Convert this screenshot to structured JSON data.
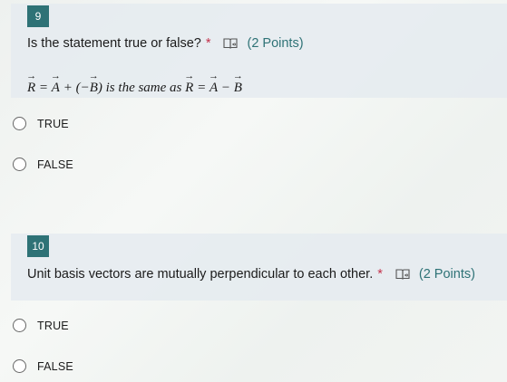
{
  "questions": [
    {
      "number": "9",
      "title": "Is the statement true or false?",
      "required_marker": "*",
      "points": "(2 Points)",
      "formula": {
        "lhs": "R",
        "eq1": "=",
        "a1": "A",
        "plus": "+ (−",
        "b1": "B",
        "close": ")",
        "middle": "is the same as",
        "r2": "R",
        "eq2": "=",
        "a2": "A",
        "minus": "−",
        "b2": "B"
      },
      "options": [
        "TRUE",
        "FALSE"
      ]
    },
    {
      "number": "10",
      "title": "Unit basis vectors are mutually perpendicular to each other.",
      "required_marker": "*",
      "points": "(2 Points)",
      "options": [
        "TRUE",
        "FALSE"
      ]
    }
  ],
  "icons": {
    "immersive_reader": "immersive-reader-icon",
    "radio": "radio-button"
  },
  "colors": {
    "accent": "#2e7276",
    "required": "#c4314b",
    "card_background": "#e6ecf0"
  }
}
